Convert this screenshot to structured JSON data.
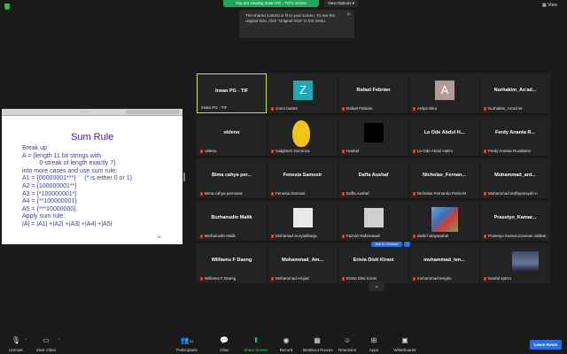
{
  "banner": {
    "text": "You are viewing Irwan PG - TIF's screen",
    "view_options": "View Options ▾",
    "view": "View"
  },
  "tooltip": {
    "text": "The shared content is fit to your screen. To see the original size, click \"Original Size\" in the menu."
  },
  "slide": {
    "title": "Sum Rule",
    "lines": [
      "Break up",
      "A = {length 11 bit strings with",
      "          0-streak of length exactly 7}",
      "into more cases and use sum rule:",
      "A1 = {00000001***}     (* is either 0 or 1)",
      "A2 = {100000001**}",
      "A3 = {*100000001*}",
      "A4 = {**100000001}",
      "A5 = {***10000000}.",
      "Apply sum rule:",
      "|A| = |A1| +|A2| +|A3| +|A4| +|A5|"
    ],
    "page": "13"
  },
  "participants": [
    {
      "big": "Irwan PG - TIF",
      "label": "Irwan PG - TIF",
      "muted": false,
      "active": true,
      "pic": ""
    },
    {
      "big": "",
      "label": "zoom baa04",
      "muted": true,
      "pic": "z",
      "pic_text": "Z"
    },
    {
      "big": "Rafael Febrian",
      "label": "Rafael Febrian",
      "muted": true,
      "pic": ""
    },
    {
      "big": "",
      "label": "Ardya Wira",
      "muted": true,
      "pic": "a",
      "pic_text": "A"
    },
    {
      "big": "Nurhakim_As'ad...",
      "label": "Nurhakim_As'ad W",
      "muted": true,
      "pic": ""
    },
    {
      "big": "oldeno",
      "label": "oldeno",
      "muted": true,
      "pic": ""
    },
    {
      "big": "",
      "label": "Galgharzi Dorionza",
      "muted": true,
      "pic": "face"
    },
    {
      "big": "",
      "label": "Haekal",
      "muted": true,
      "pic": "black"
    },
    {
      "big": "La Ode Abdul H...",
      "label": "La Ode Abdul Halim",
      "muted": true,
      "pic": ""
    },
    {
      "big": "Ferdy Ananta R...",
      "label": "Ferdy Ananta Rusdianto",
      "muted": true,
      "pic": ""
    },
    {
      "big": "Bima cahya per...",
      "label": "Bima cahya permana",
      "muted": true,
      "pic": ""
    },
    {
      "big": "Fenesia Samosir",
      "label": "Fenesia Samosir",
      "muted": true,
      "pic": ""
    },
    {
      "big": "Daffa Aushaf",
      "label": "Daffa Aushaf",
      "muted": true,
      "pic": ""
    },
    {
      "big": "Nicholas_Fernan...",
      "label": "Nicholas Fernando Putra M",
      "muted": true,
      "pic": ""
    },
    {
      "big": "Muhammad_ard...",
      "label": "Muhammad ardhiyansyah n",
      "muted": true,
      "pic": ""
    },
    {
      "big": "Burhanudin Malik",
      "label": "Burhanudin Malik",
      "muted": true,
      "pic": ""
    },
    {
      "big": "",
      "label": "Mohamad Suryadiharja",
      "muted": true,
      "pic": "avatar"
    },
    {
      "big": "",
      "label": "Fazrah Rahmawati",
      "muted": true,
      "pic": "grey"
    },
    {
      "big": "",
      "label": "dwiki hidayatullah",
      "muted": true,
      "pic": "photo"
    },
    {
      "big": "Prasetyo_Kamar...",
      "label": "Prasetyo Kamaruzzaman Jabbar",
      "muted": true,
      "pic": ""
    },
    {
      "big": "Williams F Daeng",
      "label": "Williams F Daeng",
      "muted": true,
      "pic": ""
    },
    {
      "big": "Mohammad_Am...",
      "label": "Mohammad Amjad",
      "muted": true,
      "pic": ""
    },
    {
      "big": "Erista Disti Kirani",
      "label": "Erista Disti Kirani",
      "muted": true,
      "pic": ""
    },
    {
      "big": "muhammad_ten...",
      "label": "muhammad tengku",
      "muted": true,
      "pic": ""
    },
    {
      "big": "",
      "label": "Naufal sptrcs",
      "muted": true,
      "pic": "dark"
    }
  ],
  "ask_to_unmute": "Ask to Unmute",
  "more": "···",
  "toolbar": {
    "unmute": "Unmute",
    "start_video": "Start Video",
    "participants": "Participants",
    "participants_count": "31",
    "chat": "Chat",
    "share_screen": "Share Screen",
    "record": "Record",
    "breakout_rooms": "Breakout Rooms",
    "reactions": "Reactions",
    "apps": "Apps",
    "whiteboards": "Whiteboards",
    "leave": "Leave Room"
  }
}
